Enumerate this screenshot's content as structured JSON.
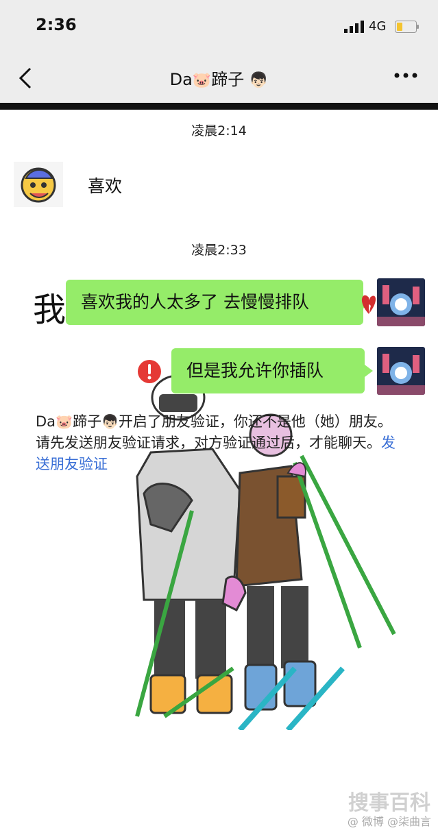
{
  "status_bar": {
    "time": "2:36",
    "network": "4G"
  },
  "header": {
    "name_prefix": "Da",
    "name_pig_emoji": "🐷",
    "name_suffix": "蹄子",
    "name_face_emoji": "👦🏻"
  },
  "messages": [
    {
      "type": "timestamp",
      "text": "凌晨2:14"
    },
    {
      "type": "received",
      "text": "喜欢"
    },
    {
      "type": "timestamp",
      "text": "凌晨2:33"
    },
    {
      "type": "overlay",
      "text": "我"
    },
    {
      "type": "sent",
      "text": "喜欢我的人太多了 去慢慢排队"
    },
    {
      "type": "sent_failed",
      "text": "但是我允许你插队"
    }
  ],
  "system_notice": {
    "name_prefix": "Da",
    "pig_emoji": "🐷",
    "name_suffix": "蹄子",
    "face_emoji": "👦🏻",
    "body": "开启了朋友验证，你还不是他（她）朋友。请先发送朋友验证请求，对方验证通过后，才能聊天。",
    "link": "发送朋友验证"
  },
  "watermark": {
    "site": "搜事百科",
    "handle": "@ 微博 @柒曲言"
  },
  "colors": {
    "bubble_green": "#95ec69",
    "header_bg": "#ededed",
    "link_blue": "#3a6fd6",
    "error_red": "#e53935"
  }
}
